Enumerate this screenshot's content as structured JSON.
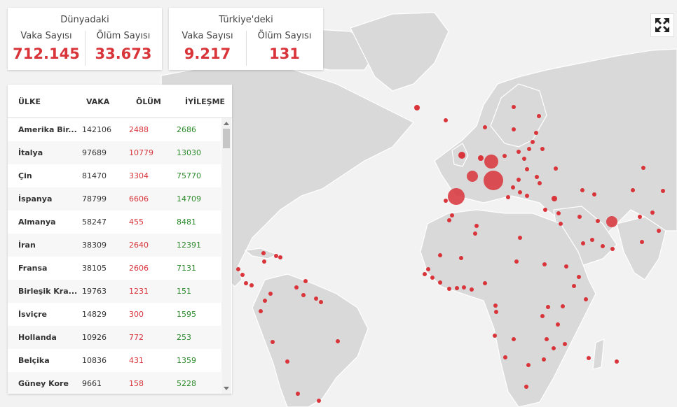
{
  "world_card": {
    "title": "Dünyadaki",
    "cases_label": "Vaka Sayısı",
    "cases_value": "712.145",
    "deaths_label": "Ölüm Sayısı",
    "deaths_value": "33.673"
  },
  "turkey_card": {
    "title": "Türkiye'deki",
    "cases_label": "Vaka Sayısı",
    "cases_value": "9.217",
    "deaths_label": "Ölüm Sayısı",
    "deaths_value": "131"
  },
  "table": {
    "headers": [
      "ÜLKE",
      "VAKA",
      "ÖLÜM",
      "İYİLEŞME"
    ],
    "rows": [
      [
        "Amerika Bir...",
        "142106",
        "2488",
        "2686"
      ],
      [
        "İtalya",
        "97689",
        "10779",
        "13030"
      ],
      [
        "Çin",
        "81470",
        "3304",
        "75770"
      ],
      [
        "İspanya",
        "78799",
        "6606",
        "14709"
      ],
      [
        "Almanya",
        "58247",
        "455",
        "8481"
      ],
      [
        "İran",
        "38309",
        "2640",
        "12391"
      ],
      [
        "Fransa",
        "38105",
        "2606",
        "7131"
      ],
      [
        "Birleşik Kra...",
        "19763",
        "1231",
        "151"
      ],
      [
        "İsviçre",
        "14829",
        "300",
        "1595"
      ],
      [
        "Hollanda",
        "10926",
        "772",
        "253"
      ],
      [
        "Belçika",
        "10836",
        "431",
        "1359"
      ],
      [
        "Güney Kore",
        "9661",
        "158",
        "5228"
      ]
    ]
  },
  "colors": {
    "accent": "#d8343a",
    "recovered": "#2b8a2b",
    "land": "#d9d9d9",
    "sea": "#f2f2f2"
  },
  "icons": {
    "fullscreen": "fullscreen-expand-icon",
    "scroll_up": "scroll-up-arrow-icon",
    "scroll_down": "scroll-down-arrow-icon"
  }
}
